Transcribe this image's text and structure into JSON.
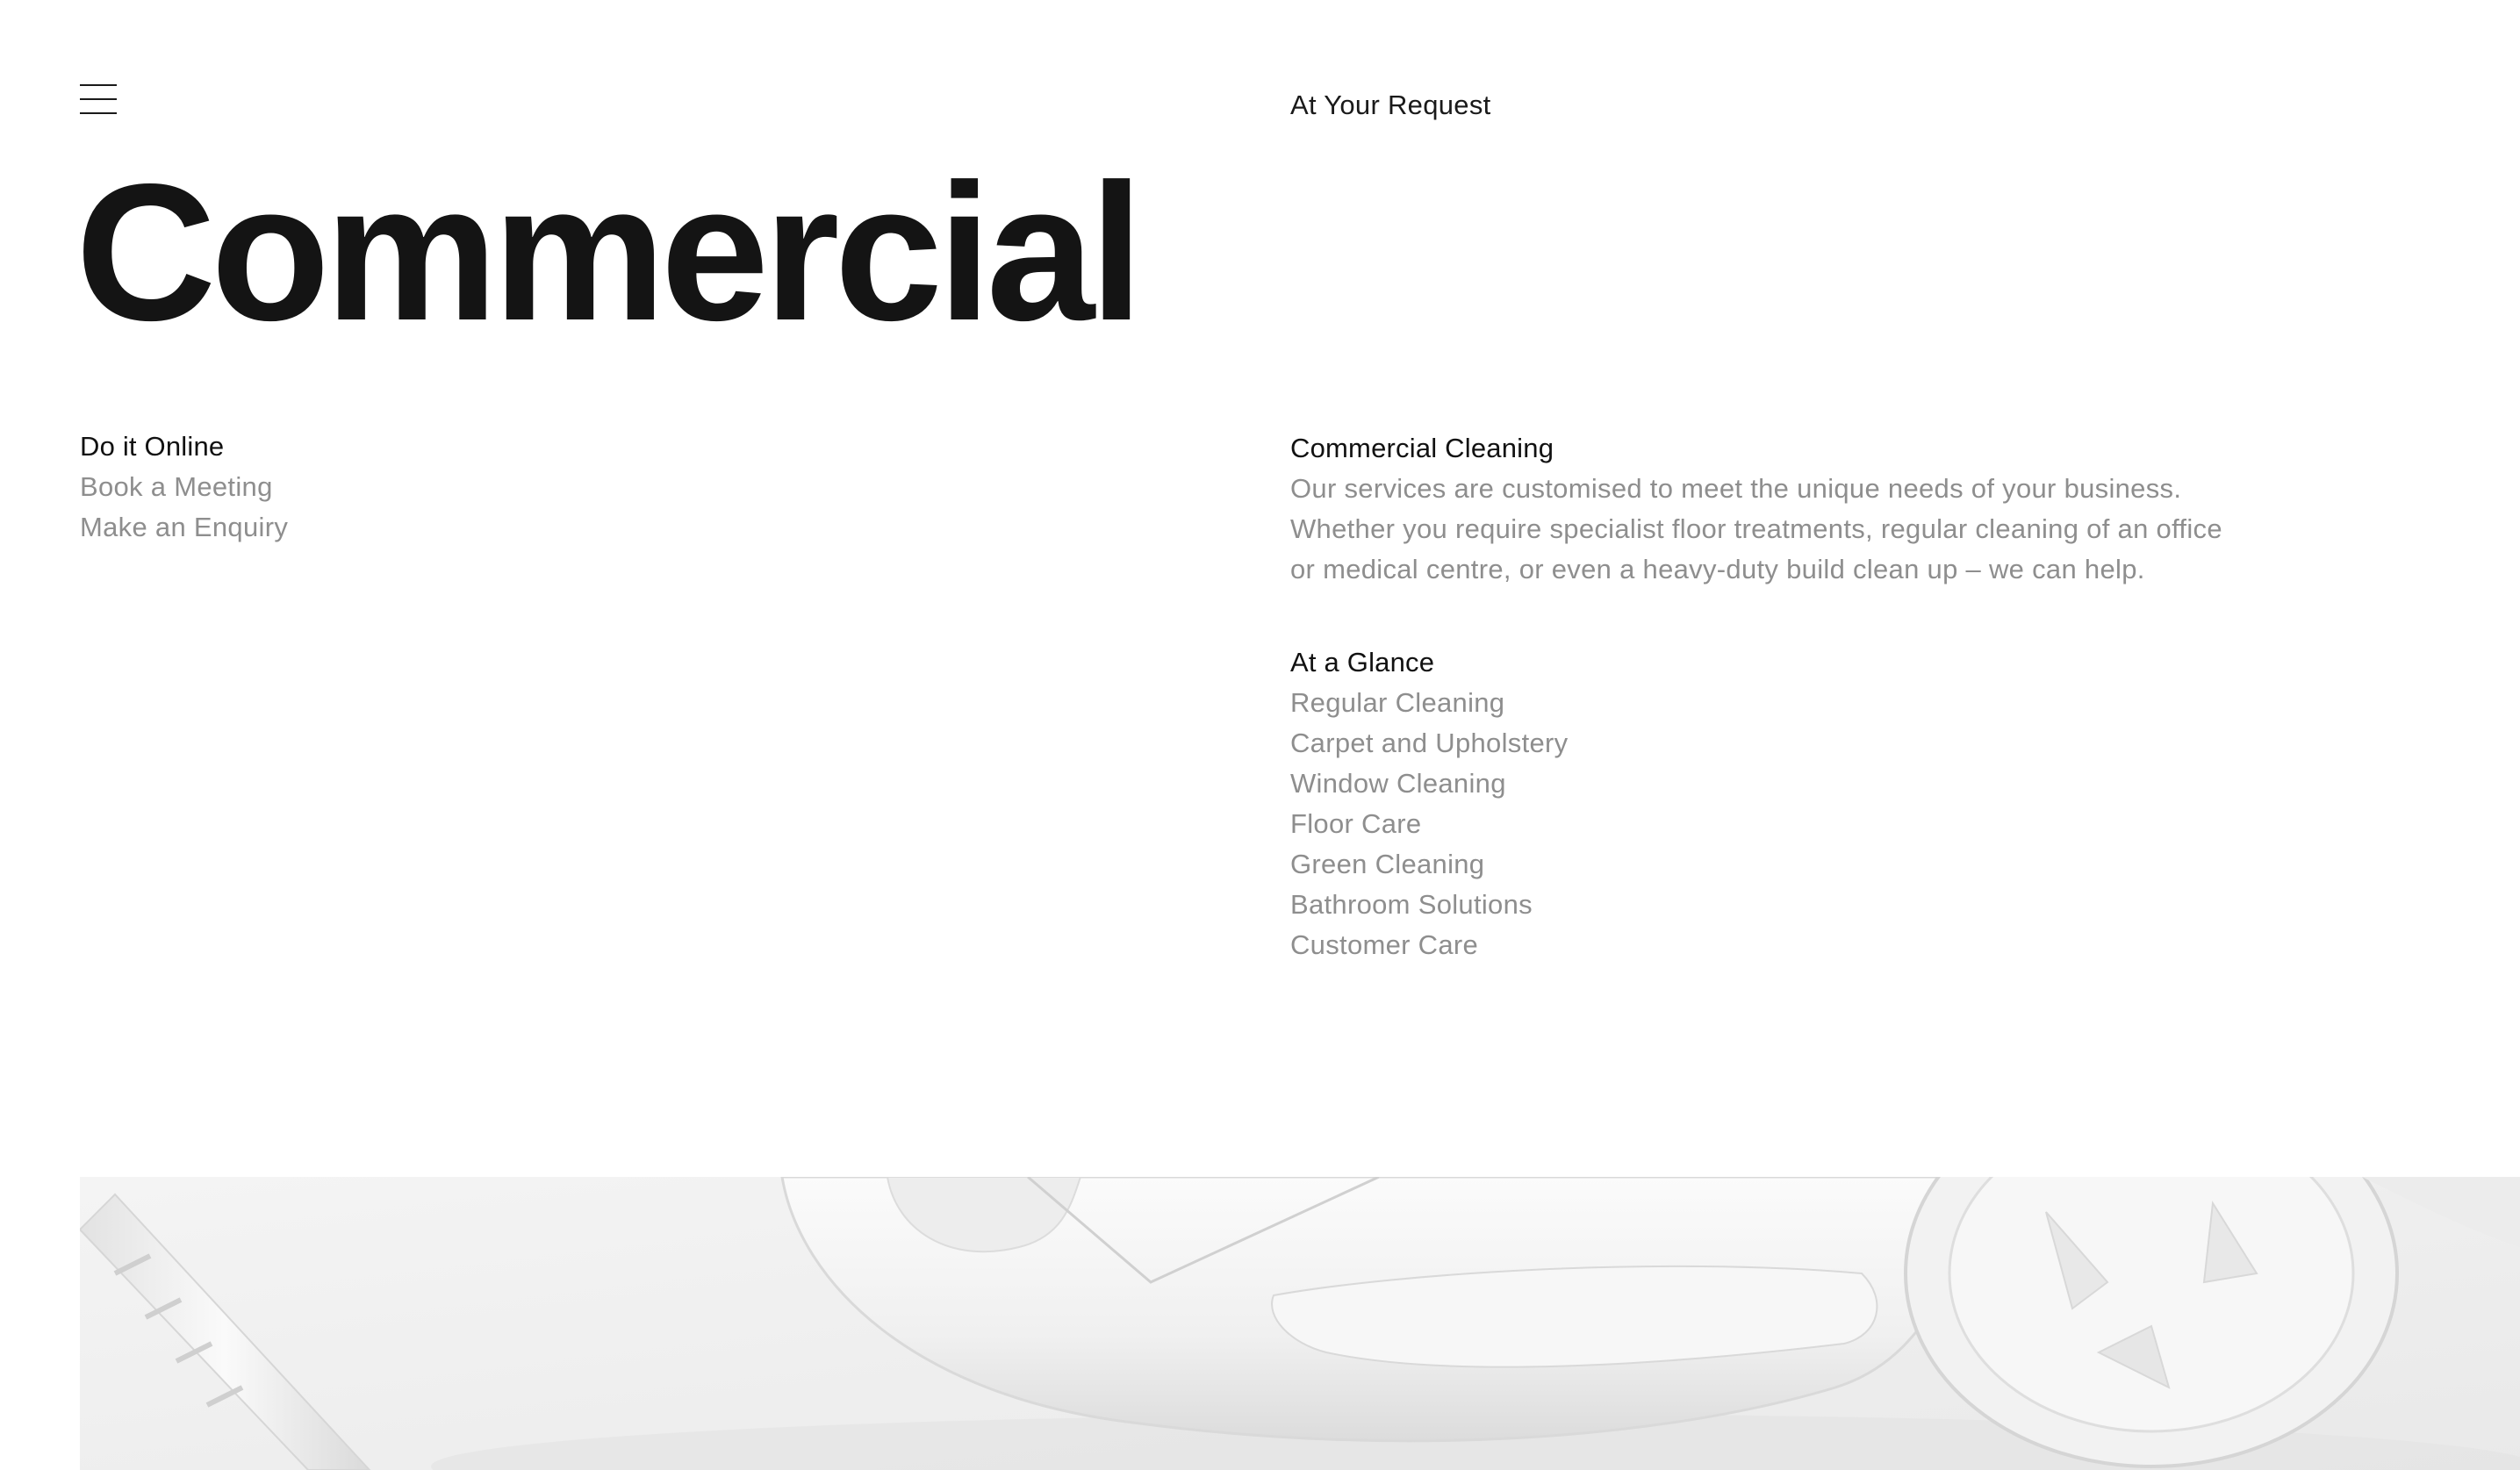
{
  "header": {
    "menu_icon": "hamburger-menu-icon",
    "top_link": "At Your Request"
  },
  "hero": {
    "title": "Commercial"
  },
  "online": {
    "heading": "Do it Online",
    "links": [
      "Book a Meeting",
      "Make an Enquiry"
    ]
  },
  "service": {
    "heading": "Commercial Cleaning",
    "description": "Our services are customised to meet the unique needs of your business. Whether you require specialist floor treatments, regular cleaning of an office or medical centre, or even a heavy-duty build clean up – we can help."
  },
  "glance": {
    "heading": "At a Glance",
    "items": [
      "Regular Cleaning",
      "Carpet and Upholstery",
      "Window Cleaning",
      "Floor Care",
      "Green Cleaning",
      "Bathroom Solutions",
      "Customer Care"
    ]
  },
  "image": {
    "subject": "white-vacuum-cleaner-photo"
  },
  "colors": {
    "text_primary": "#111111",
    "text_muted": "#8e8e8e",
    "background": "#ffffff",
    "image_background": "#f1f1f1"
  }
}
